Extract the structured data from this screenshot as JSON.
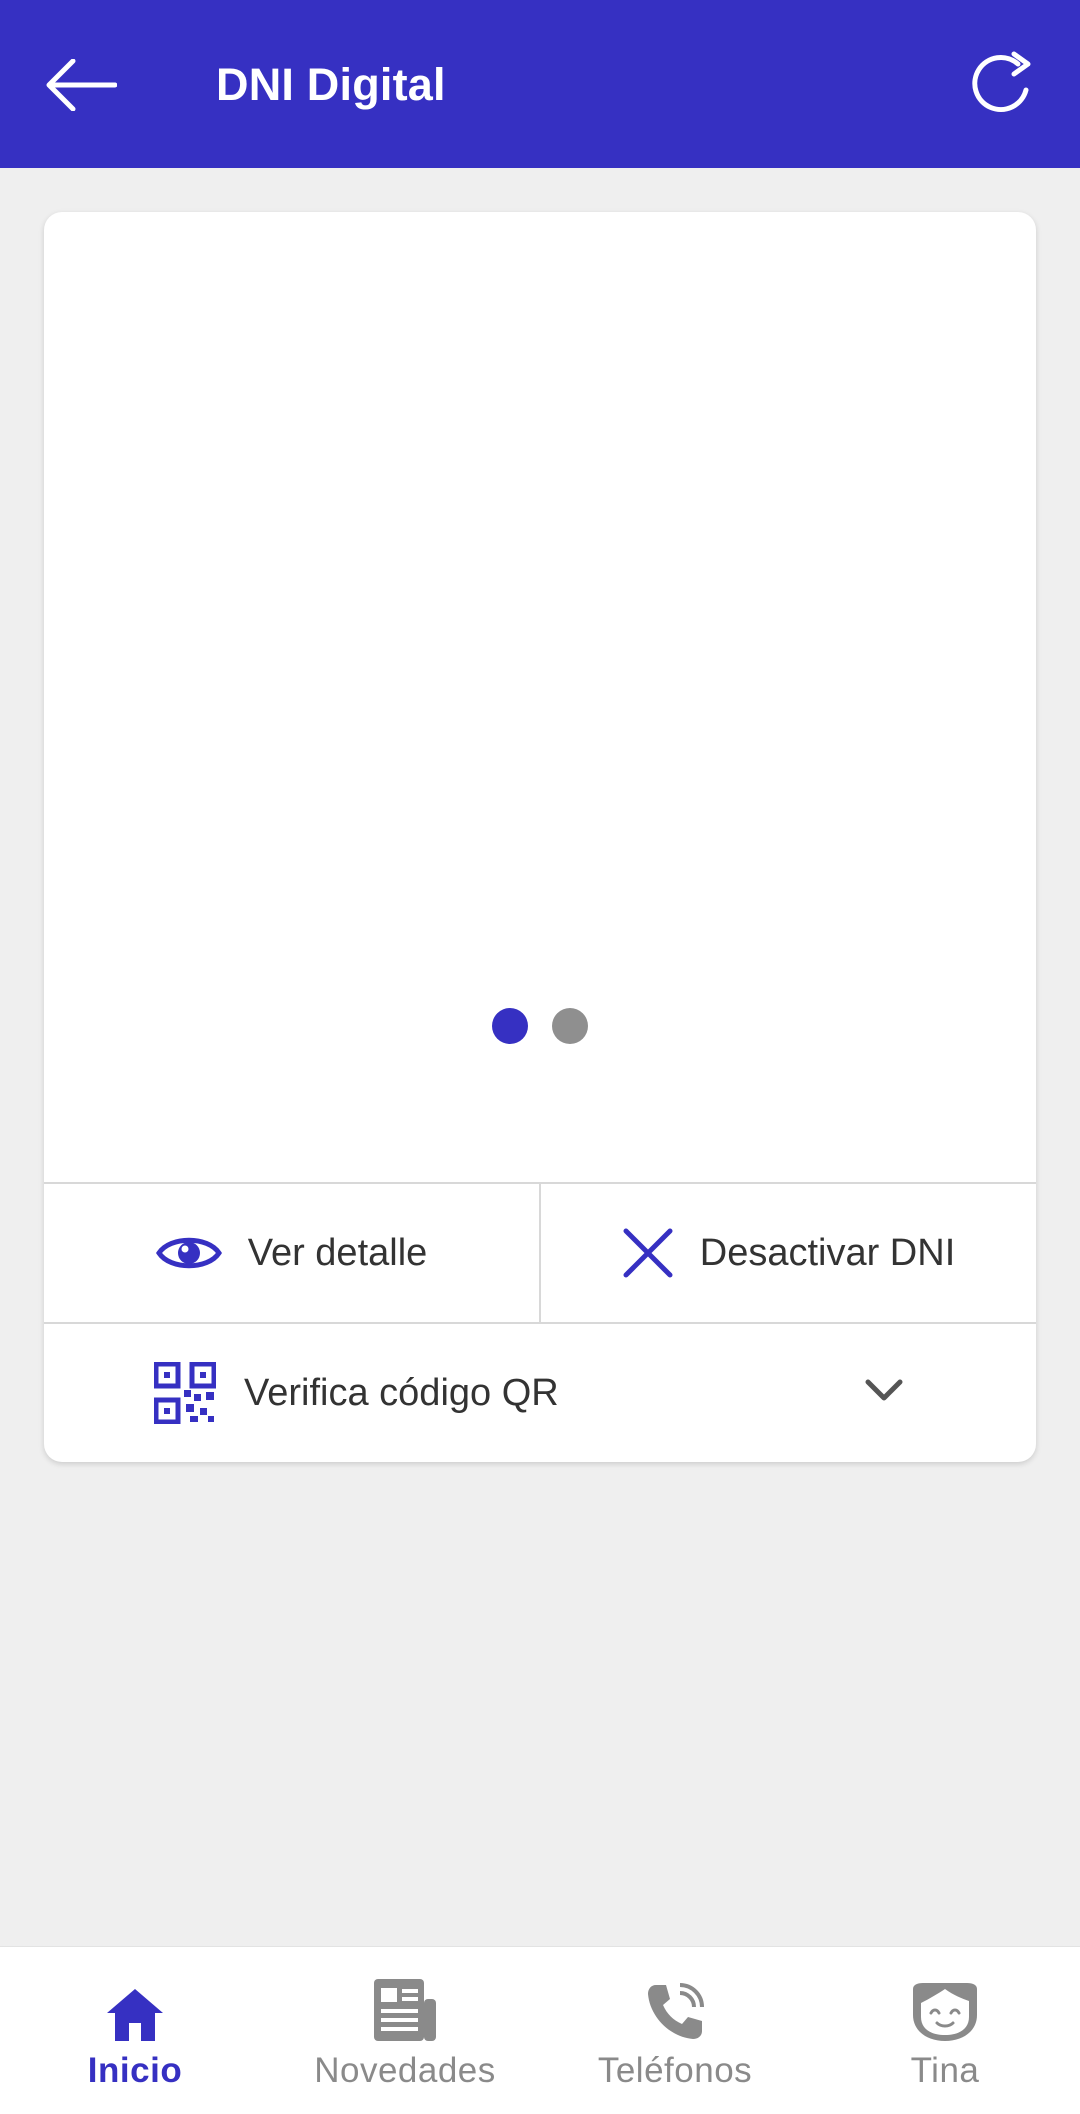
{
  "appbar": {
    "title": "DNI Digital",
    "back_icon": "arrow-left-icon",
    "refresh_icon": "refresh-icon",
    "color": "#3630c2"
  },
  "card": {
    "carousel": {
      "page_count": 2,
      "active_page": 1
    },
    "actions": {
      "view_label": "Ver detalle",
      "view_icon": "eye-icon",
      "deactivate_label": "Desactivar DNI",
      "deactivate_icon": "close-icon"
    },
    "qr": {
      "label": "Verifica código QR",
      "icon": "qr-code-icon",
      "expand_icon": "chevron-down-icon"
    }
  },
  "bottom_nav": {
    "items": [
      {
        "label": "Inicio",
        "icon": "home-icon",
        "active": true
      },
      {
        "label": "Novedades",
        "icon": "newspaper-icon",
        "active": false
      },
      {
        "label": "Teléfonos",
        "icon": "phone-icon",
        "active": false
      },
      {
        "label": "Tina",
        "icon": "assistant-face-icon",
        "active": false
      }
    ],
    "active_color": "#3630c2",
    "inactive_color": "#8a8a8a"
  }
}
